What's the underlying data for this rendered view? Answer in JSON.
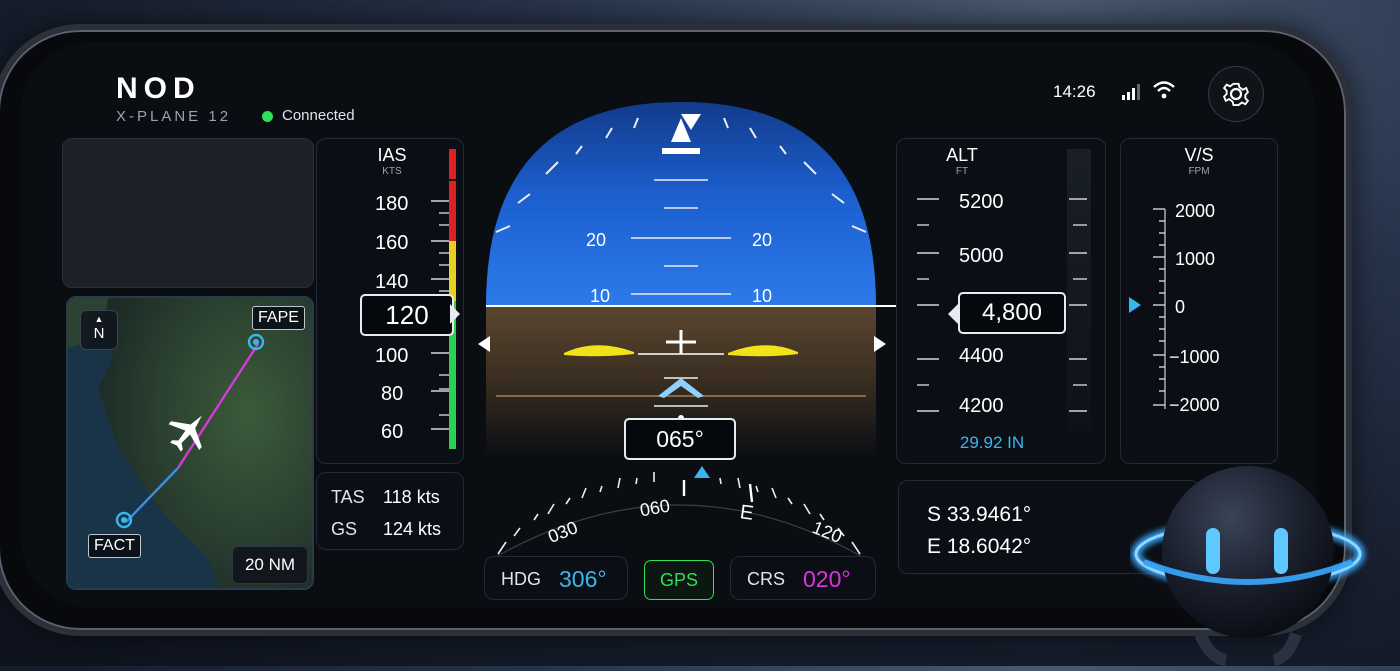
{
  "app": {
    "brand": "NOD",
    "sim_name": "X-PLANE 12",
    "connection_status": "Connected",
    "time": "14:26"
  },
  "map": {
    "north_label": "N",
    "waypoint_from": "FACT",
    "waypoint_to": "FAPE",
    "range": "20 NM"
  },
  "airspeed": {
    "title": "IAS",
    "unit": "KTS",
    "current": "120",
    "ticks": [
      "180",
      "160",
      "140",
      "100",
      "80",
      "60"
    ]
  },
  "speeds": {
    "tas_label": "TAS",
    "tas_value": "118 kts",
    "gs_label": "GS",
    "gs_value": "124 kts"
  },
  "attitude": {
    "pitch_labels_left": [
      "20",
      "10"
    ],
    "pitch_labels_right": [
      "20",
      "10"
    ]
  },
  "heading": {
    "current": "065°",
    "compass_labels": [
      "030",
      "060",
      "E",
      "120"
    ]
  },
  "nav": {
    "hdg_label": "HDG",
    "hdg_value": "306°",
    "source": "GPS",
    "crs_label": "CRS",
    "crs_value": "020°"
  },
  "altitude": {
    "title": "ALT",
    "unit": "FT",
    "current": "4,800",
    "ticks": [
      "5200",
      "5000",
      "4400",
      "4200"
    ],
    "baro": "29.92 IN"
  },
  "vertical_speed": {
    "title": "V/S",
    "unit": "FPM",
    "ticks": [
      "2000",
      "1000",
      "0",
      "−1000",
      "−2000"
    ]
  },
  "position": {
    "lat": "S 33.9461°",
    "lon": "E 18.6042°"
  },
  "colors": {
    "accent_cyan": "#38b6f0",
    "magenta": "#e030e0",
    "green": "#2ee05a",
    "sky": "#1f6fd6",
    "ground": "#4b3d2a"
  }
}
